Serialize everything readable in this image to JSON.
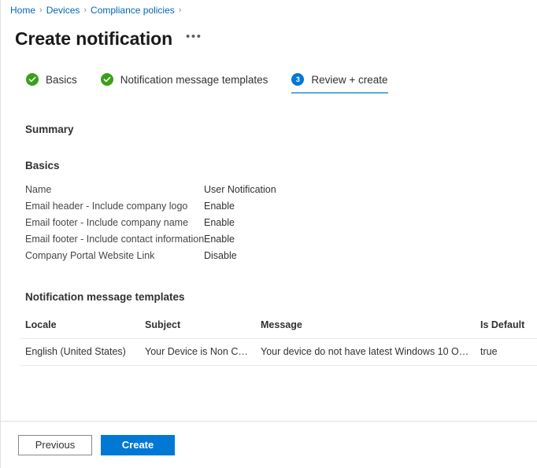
{
  "breadcrumb": {
    "separator": "›",
    "items": [
      {
        "label": "Home"
      },
      {
        "label": "Devices"
      },
      {
        "label": "Compliance policies"
      }
    ]
  },
  "header": {
    "title": "Create notification",
    "more_label": "•••"
  },
  "wizard": {
    "steps": [
      {
        "label": "Basics",
        "state": "done",
        "badge": "check"
      },
      {
        "label": "Notification message templates",
        "state": "done",
        "badge": "check"
      },
      {
        "label": "Review + create",
        "state": "current",
        "badge": "3"
      }
    ]
  },
  "main": {
    "summary_heading": "Summary",
    "basics": {
      "heading": "Basics",
      "rows": [
        {
          "key": "Name",
          "value": "User Notification"
        },
        {
          "key": "Email header - Include company logo",
          "value": "Enable"
        },
        {
          "key": "Email footer - Include company name",
          "value": "Enable"
        },
        {
          "key": "Email footer - Include contact information",
          "value": "Enable"
        },
        {
          "key": "Company Portal Website Link",
          "value": "Disable"
        }
      ]
    },
    "templates": {
      "heading": "Notification message templates",
      "columns": [
        "Locale",
        "Subject",
        "Message",
        "Is Default"
      ],
      "rows": [
        {
          "locale": "English (United States)",
          "subject": "Your Device is Non Co...",
          "message": "Your device do not have latest Windows 10 Op...",
          "is_default": "true"
        }
      ]
    }
  },
  "footer": {
    "previous_label": "Previous",
    "create_label": "Create"
  },
  "colors": {
    "accent": "#0078d4",
    "success": "#3aa017",
    "link": "#0067b8",
    "active_underline": "#5fa8dd"
  }
}
